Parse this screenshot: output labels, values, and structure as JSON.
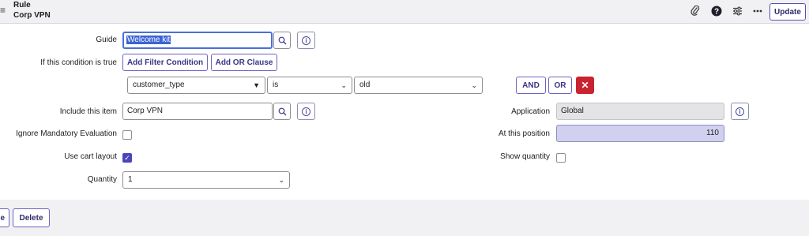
{
  "header": {
    "record_type": "Rule",
    "record_name": "Corp VPN",
    "update_label": "Update",
    "icons": [
      "menu-icon",
      "paperclip-icon",
      "help-icon",
      "settings-sliders-icon",
      "more-icon"
    ]
  },
  "form": {
    "guide": {
      "label": "Guide",
      "value": "Welcome kit"
    },
    "condition": {
      "label": "If this condition is true",
      "add_filter_label": "Add Filter Condition",
      "add_or_label": "Add OR Clause",
      "field_value": "customer_type",
      "operator_value": "is",
      "value_value": "old",
      "and_label": "AND",
      "or_label": "OR"
    },
    "include_item": {
      "label": "Include this item",
      "value": "Corp VPN"
    },
    "application": {
      "label": "Application",
      "value": "Global"
    },
    "ignore_mandatory": {
      "label": "Ignore Mandatory Evaluation",
      "checked": false
    },
    "position": {
      "label": "At this position",
      "value": "110"
    },
    "cart_layout": {
      "label": "Use cart layout",
      "checked": true
    },
    "show_quantity": {
      "label": "Show quantity",
      "checked": false
    },
    "quantity": {
      "label": "Quantity",
      "value": "1"
    }
  },
  "footer": {
    "partial_button_label": "e",
    "delete_label": "Delete"
  },
  "colors": {
    "accent": "#4b46b8",
    "delete_red": "#c8232f",
    "header_bg": "#f1f1f3",
    "position_bg": "#d1d1ef"
  }
}
